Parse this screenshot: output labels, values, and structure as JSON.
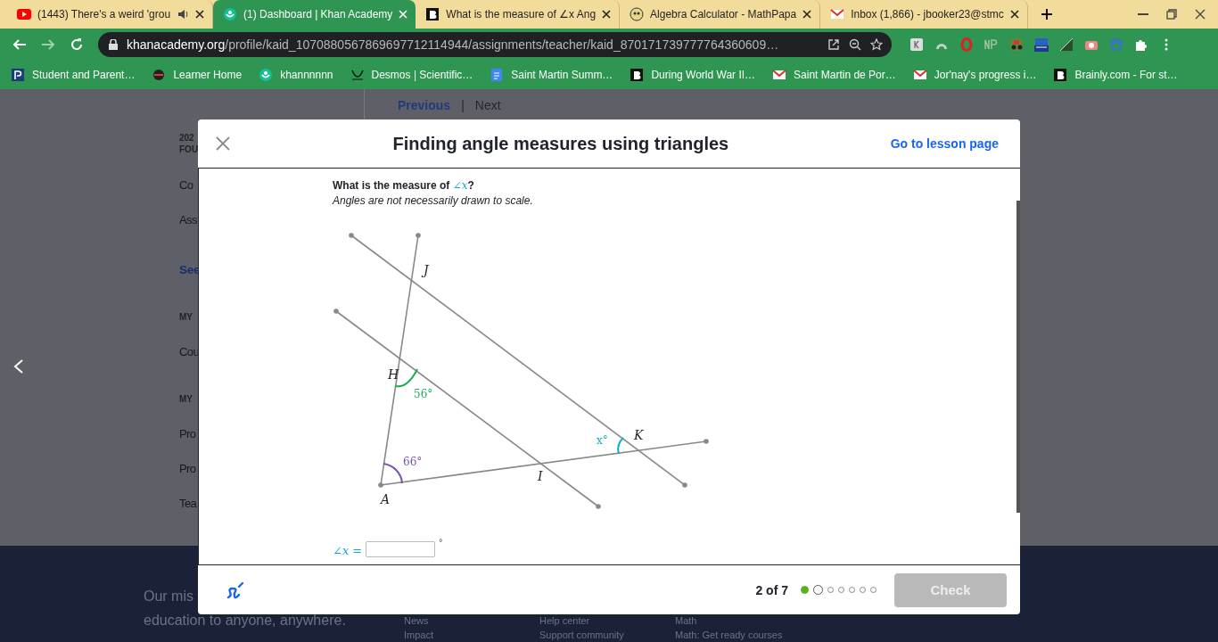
{
  "browser": {
    "tabs": [
      {
        "title": "(1443) There's a weird 'grou",
        "kind": "youtube",
        "audio": true,
        "selected": false
      },
      {
        "title": "(1) Dashboard | Khan Academy",
        "kind": "khan",
        "audio": false,
        "selected": true
      },
      {
        "title": "What is the measure of ∠x Ang",
        "kind": "brainly",
        "audio": false,
        "selected": false
      },
      {
        "title": "Algebra Calculator - MathPapa",
        "kind": "mathpapa",
        "audio": false,
        "selected": false
      },
      {
        "title": "Inbox (1,866) - jbooker23@stmc",
        "kind": "gmail",
        "audio": false,
        "selected": false
      }
    ],
    "address": {
      "host": "khanacademy.org",
      "path": "/profile/kaid_1070880567869697712114944/assignments/teacher/kaid_870171739777764360609…"
    },
    "bookmarks": [
      {
        "label": "Student and Parent…",
        "kind": "powerschool"
      },
      {
        "label": "Learner Home",
        "kind": "learner"
      },
      {
        "label": "khannnnnn",
        "kind": "khan"
      },
      {
        "label": "Desmos | Scientific…",
        "kind": "desmos"
      },
      {
        "label": "Saint Martin Summ…",
        "kind": "docs"
      },
      {
        "label": "During World War II…",
        "kind": "brainly"
      },
      {
        "label": "Saint Martin de Por…",
        "kind": "gmail"
      },
      {
        "label": "Jor'nay's progress i…",
        "kind": "gmail"
      },
      {
        "label": "Brainly.com - For st…",
        "kind": "brainly"
      }
    ]
  },
  "background_page": {
    "pager": [
      {
        "label": "Previous",
        "disabled": false
      },
      {
        "label": "Next",
        "disabled": true
      }
    ],
    "pager_separator": "|",
    "sidebar": [
      {
        "text": "202",
        "kind": "caption"
      },
      {
        "text": "FOU",
        "kind": "caption"
      },
      {
        "text": "Co",
        "kind": "item"
      },
      {
        "text": "Ass",
        "kind": "item"
      },
      {
        "text": "See",
        "kind": "link"
      },
      {
        "text": "MY",
        "kind": "heading"
      },
      {
        "text": "Cou",
        "kind": "item"
      },
      {
        "text": "MY",
        "kind": "heading"
      },
      {
        "text": "Pro",
        "kind": "item"
      },
      {
        "text": "Pro",
        "kind": "item"
      },
      {
        "text": "Tea",
        "kind": "item"
      }
    ],
    "footer": {
      "mission": [
        "Our mis",
        "education to anyone, anywhere."
      ],
      "link_rows": [
        [
          "News",
          "Help center",
          "Math"
        ],
        [
          "Impact",
          "Support community",
          "Math: Get ready courses"
        ]
      ]
    }
  },
  "modal": {
    "title": "Finding angle measures using triangles",
    "lesson_link": "Go to lesson page",
    "question": {
      "prompt": "What is the measure of ",
      "prompt_math": "∠x",
      "prompt_end": "?",
      "note": "Angles are not necessarily drawn to scale.",
      "points": [
        {
          "label": "J"
        },
        {
          "label": "H"
        },
        {
          "label": "K"
        },
        {
          "label": "I"
        },
        {
          "label": "A"
        }
      ],
      "angles": [
        {
          "label": "56°",
          "color": "#1fab54"
        },
        {
          "label": "66°",
          "color": "#7854ab"
        },
        {
          "label": "x°",
          "color": "#11accd"
        }
      ],
      "answer_label": "∠x =",
      "answer_unit": "°"
    },
    "footer": {
      "progress": "2 of 7",
      "steps": [
        {
          "completed": true,
          "selected": false
        },
        {
          "completed": false,
          "selected": true
        },
        {
          "completed": false,
          "selected": false
        },
        {
          "completed": false,
          "selected": false
        },
        {
          "completed": false,
          "selected": false
        },
        {
          "completed": false,
          "selected": false
        },
        {
          "completed": false,
          "selected": false
        }
      ],
      "check": {
        "label": "Check",
        "disabled": true
      }
    }
  }
}
